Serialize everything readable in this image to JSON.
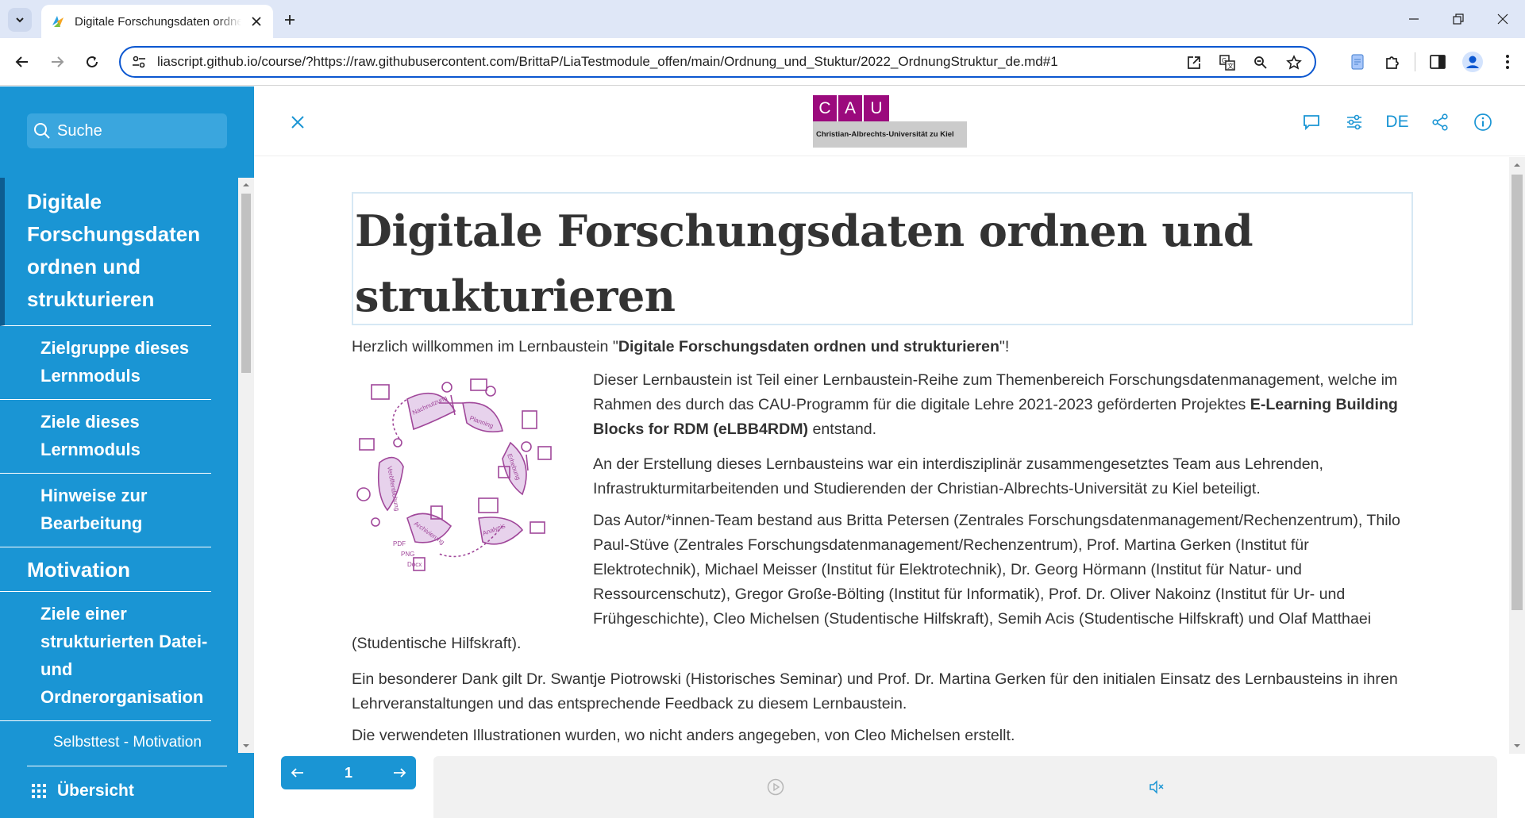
{
  "browser": {
    "tab_title": "Digitale Forschungsdaten ordnen und strukturieren",
    "url": "liascript.github.io/course/?https://raw.githubusercontent.com/BrittaP/LiaTestmodule_offen/main/Ordnung_und_Stuktur/2022_OrdnungStruktur_de.md#1"
  },
  "sidebar": {
    "search_placeholder": "Suche",
    "toc": [
      {
        "label": "Digitale Forschungsdaten ordnen und strukturieren",
        "level": 1,
        "active": true
      },
      {
        "label": "Zielgruppe dieses Lernmoduls",
        "level": 2
      },
      {
        "label": "Ziele dieses Lernmoduls",
        "level": 2
      },
      {
        "label": "Hinweise zur Bearbeitung",
        "level": 2
      },
      {
        "label": "Motivation",
        "level": 1
      },
      {
        "label": "Ziele einer strukturierten Datei- und Ordnerorganisation",
        "level": 2
      },
      {
        "label": "Selbsttest - Motivation",
        "level": 3
      }
    ],
    "overview_label": "Übersicht"
  },
  "header": {
    "logo_letters": [
      "C",
      "A",
      "U"
    ],
    "logo_caption": "Christian-Albrechts-Universität zu Kiel",
    "language": "DE"
  },
  "content": {
    "title": "Digitale Forschungsdaten ordnen und strukturieren",
    "welcome_prefix": "Herzlich willkommen im Lernbaustein \"",
    "welcome_bold": "Digitale Forschungsdaten ordnen und strukturieren",
    "welcome_suffix": "\"!",
    "p1_text": "Dieser Lernbaustein ist Teil einer Lernbaustein-Reihe zum Themenbereich Forschungsdatenmanagement, welche im Rahmen des durch das CAU-Programm für die digitale Lehre 2021-2023 geförderten Projektes ",
    "p1_bold": "E-Learning Building Blocks for RDM (eLBB4RDM)",
    "p1_suffix": " entstand.",
    "p2": "An der Erstellung dieses Lernbausteins war ein interdisziplinär zusammengesetztes Team aus Lehrenden, Infrastrukturmitarbeitenden und Studierenden der Christian-Albrechts-Universität zu Kiel beteiligt.",
    "p3": "Das Autor/*innen-Team bestand aus Britta Petersen (Zentrales Forschungsdatenmanagement/Rechenzentrum), Thilo Paul-Stüve (Zentrales Forschungsdatenmanagement/Rechenzentrum), Prof. Martina Gerken (Institut für Elektrotechnik), Michael Meisser (Institut für Elektrotechnik), Dr. Georg Hörmann (Institut für Natur- und Ressourcenschutz), Gregor Große-Bölting (Institut für Informatik), Prof. Dr. Oliver Nakoinz (Institut für Ur- und Frühgeschichte), Cleo Michelsen (Studentische Hilfskraft), Semih Acis (Studentische Hilfskraft) und Olaf Matthaei",
    "p3_tail": "(Studentische Hilfskraft).",
    "p4": "Ein besonderer Dank gilt Dr. Swantje Piotrowski (Historisches Seminar) und Prof. Dr. Martina Gerken für den initialen Einsatz des Lernbausteins in ihren Lehrveranstaltungen und das entsprechende Feedback zu diesem Lernbaustein.",
    "p5": "Die verwendeten Illustrationen wurden, wo nicht anders angegeben, von Cleo Michelsen erstellt.",
    "illustration_labels": [
      "Planning",
      "Erhebung",
      "Analysis",
      "Archivierung",
      "Veröffentlichung",
      "Nachnutzung"
    ],
    "illustration_formats": [
      "PDF",
      "PNG",
      "Docx"
    ]
  },
  "pager": {
    "page": "1"
  },
  "colors": {
    "accent": "#1a95d4",
    "cau_purple": "#9b0a7d",
    "illustration": "#a0479a"
  }
}
